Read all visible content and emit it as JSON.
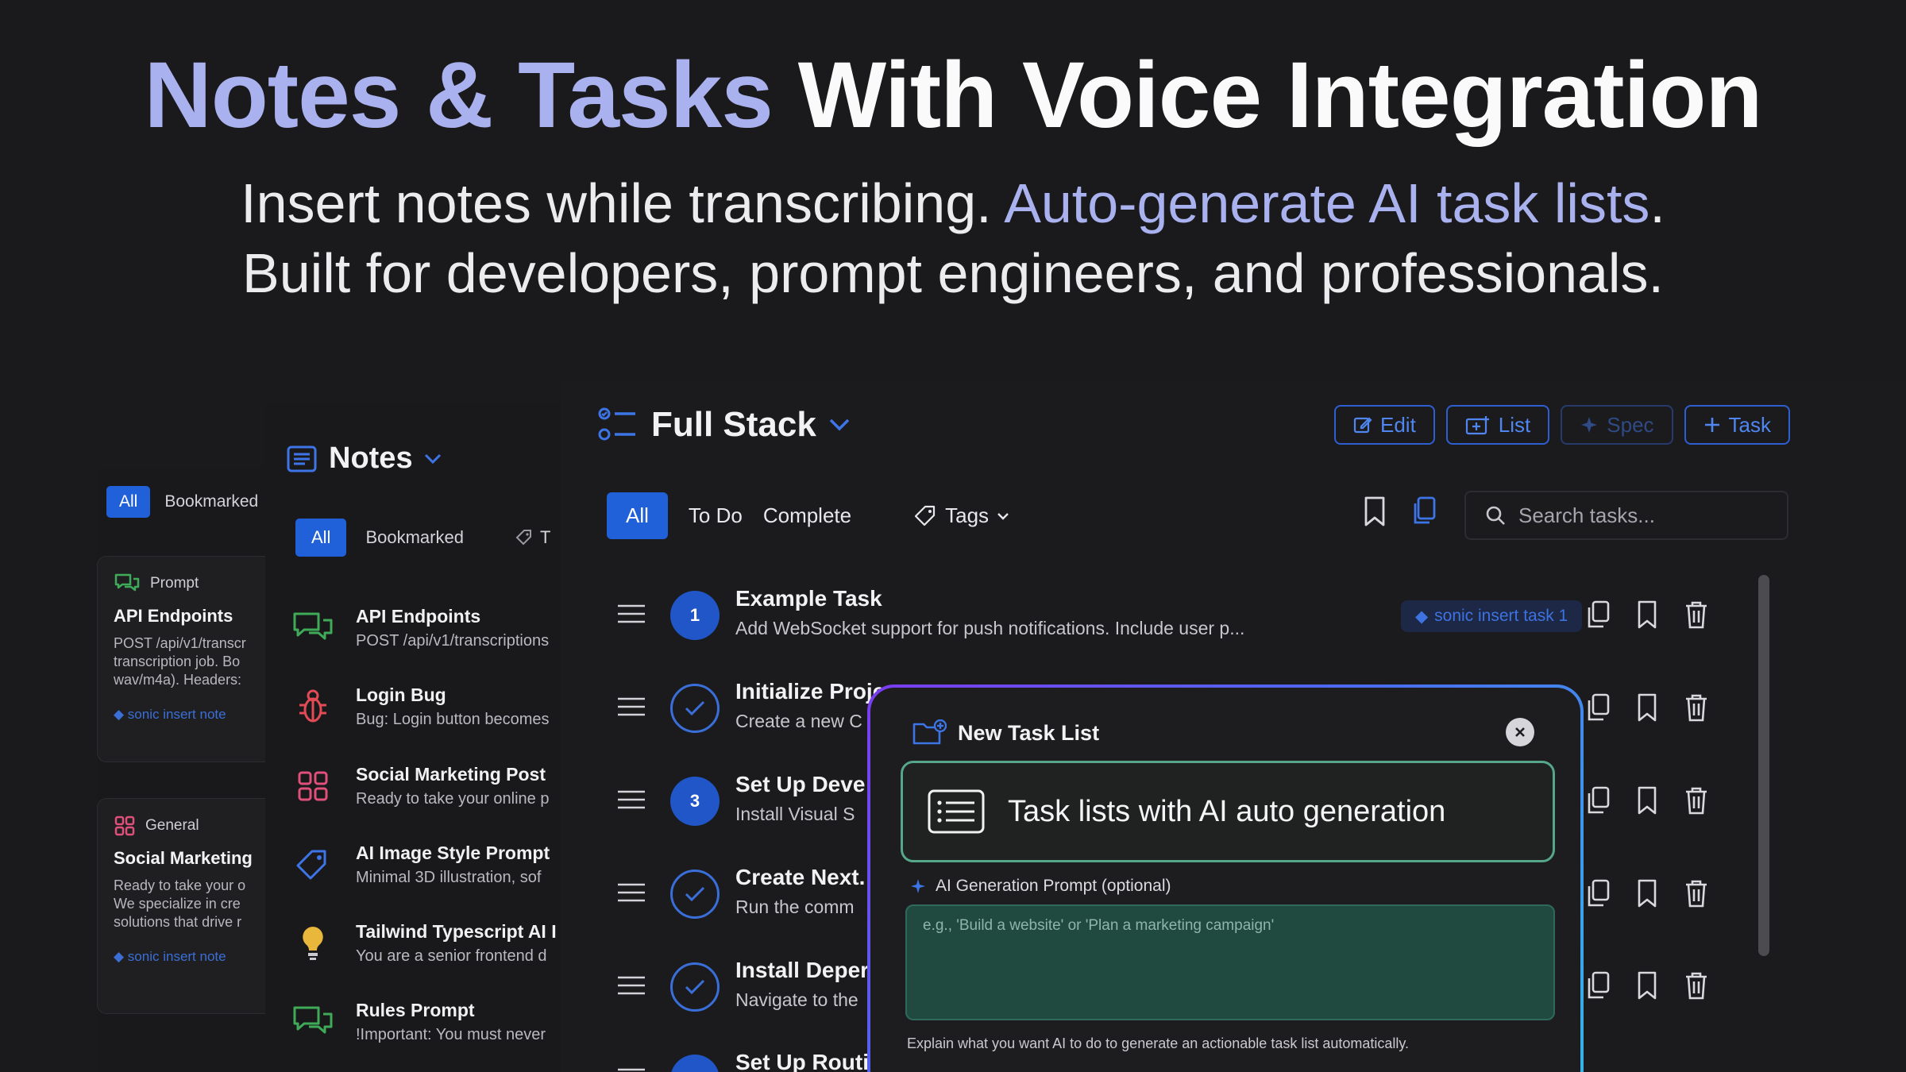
{
  "hero": {
    "title_accent": "Notes & Tasks",
    "title_rest": " With Voice Integration",
    "sub_line1_a": "Insert notes while transcribing. ",
    "sub_line1_accent": "Auto-generate AI task lists",
    "sub_line1_b": ".",
    "sub_line2": "Built for developers, prompt engineers, and professionals."
  },
  "back_panel": {
    "tab_all": "All",
    "tab_bookmarked": "Bookmarked",
    "cards": [
      {
        "category": "Prompt",
        "title": "API Endpoints",
        "body": "POST /api/v1/transcr\ntranscription job. Bo\nwav/m4a). Headers:",
        "tag": "sonic insert note"
      },
      {
        "category": "General",
        "title": "Social Marketing",
        "body": "Ready to take your o\nWe specialize in cre\nsolutions that drive r",
        "tag": "sonic insert note"
      }
    ]
  },
  "notes_panel": {
    "title": "Notes",
    "tab_all": "All",
    "tab_bookmarked": "Bookmarked",
    "tab_tags": "T",
    "items": [
      {
        "icon": "chat-bubbles-icon",
        "title": "API Endpoints",
        "desc": "POST /api/v1/transcriptions"
      },
      {
        "icon": "bug-icon",
        "title": "Login Bug",
        "desc": "Bug: Login button becomes"
      },
      {
        "icon": "grid-icon",
        "title": "Social Marketing Post",
        "desc": "Ready to take your online p"
      },
      {
        "icon": "tag-icon",
        "title": "AI Image Style Prompt",
        "desc": "Minimal 3D illustration, sof"
      },
      {
        "icon": "lightbulb-icon",
        "title": "Tailwind Typescript AI I",
        "desc": "You are a senior frontend d"
      },
      {
        "icon": "chat-bubbles-icon",
        "title": "Rules Prompt",
        "desc": "!Important: You must never"
      }
    ]
  },
  "main": {
    "title": "Full Stack",
    "buttons": {
      "edit": "Edit",
      "list": "List",
      "spec": "Spec",
      "task": "Task"
    },
    "filters": {
      "all": "All",
      "todo": "To Do",
      "complete": "Complete",
      "tags": "Tags"
    },
    "search_placeholder": "Search tasks...",
    "tasks": [
      {
        "marker": "1",
        "done": false,
        "title": "Example Task",
        "desc": "Add WebSocket support for push notifications. Include user p...",
        "tag": "sonic insert task 1"
      },
      {
        "marker": "",
        "done": true,
        "title": "Initialize Proje",
        "desc": "Create a new C",
        "tag": ""
      },
      {
        "marker": "3",
        "done": false,
        "title": "Set Up Deve",
        "desc": "Install Visual S",
        "tag": ""
      },
      {
        "marker": "",
        "done": true,
        "title": "Create Next.",
        "desc": "Run the comm",
        "tag": ""
      },
      {
        "marker": "",
        "done": true,
        "title": "Install Deper",
        "desc": "Navigate to the",
        "tag": ""
      },
      {
        "marker": "",
        "done": false,
        "title": "Set Up Routi",
        "desc": "",
        "tag": ""
      }
    ]
  },
  "modal": {
    "title": "New Task List",
    "banner": "Task lists with AI auto generation",
    "prompt_label": "AI Generation Prompt (optional)",
    "prompt_placeholder": "e.g., 'Build a website' or 'Plan a marketing campaign'",
    "help": "Explain what you want AI to do to generate an actionable task list automatically."
  },
  "colors": {
    "accent_blue": "#2060d8",
    "hero_accent": "#a9b2ee",
    "modal_green": "#56a78a",
    "background": "#1a1a1d"
  }
}
